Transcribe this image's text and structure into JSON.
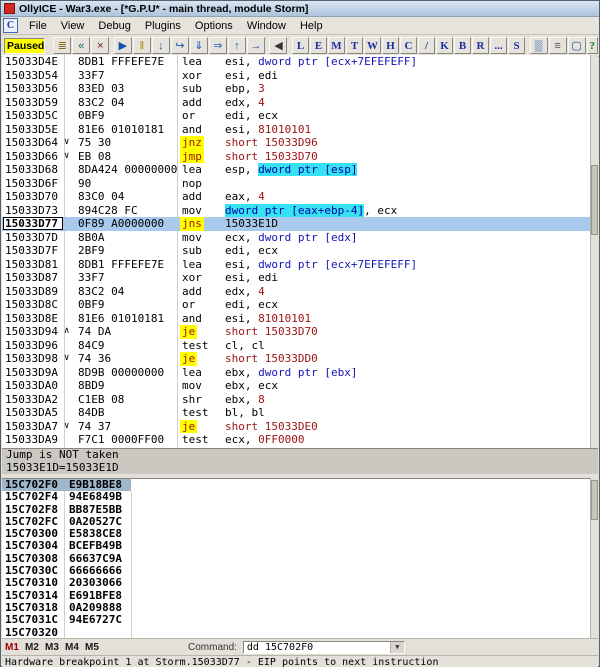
{
  "window": {
    "title": "OllyICE - War3.exe - [*G.P.U* - main thread, module Storm]"
  },
  "menu": {
    "items": [
      "File",
      "View",
      "Debug",
      "Plugins",
      "Options",
      "Window",
      "Help"
    ]
  },
  "toolbar": {
    "status": "Paused",
    "buttons_left": [
      {
        "name": "open-file",
        "glyph": "≣",
        "color": "#8A6D1A"
      },
      {
        "name": "restart",
        "glyph": "«",
        "color": "#0A6A6A"
      },
      {
        "name": "close",
        "glyph": "×",
        "color": "#7A1010"
      }
    ],
    "buttons_run": [
      {
        "name": "run",
        "glyph": "▶",
        "color": "#1553A8"
      },
      {
        "name": "pause",
        "glyph": "‖",
        "color": "#A88A00"
      },
      {
        "name": "step-into",
        "glyph": "↓",
        "color": "#1553A8"
      },
      {
        "name": "step-over",
        "glyph": "↪",
        "color": "#1553A8"
      },
      {
        "name": "animate-into",
        "glyph": "⇓",
        "color": "#1553A8"
      },
      {
        "name": "animate-over",
        "glyph": "⇒",
        "color": "#1553A8"
      },
      {
        "name": "execute-till-return",
        "glyph": "↑",
        "color": "#1553A8"
      },
      {
        "name": "go-to",
        "glyph": "→",
        "color": "#1553A8"
      }
    ],
    "buttons_mid": [
      {
        "name": "go-to-previous",
        "glyph": "◀",
        "color": "#333333"
      }
    ],
    "letter_buttons": [
      {
        "label": "L",
        "name": "log"
      },
      {
        "label": "E",
        "name": "executables"
      },
      {
        "label": "M",
        "name": "memory-map"
      },
      {
        "label": "T",
        "name": "threads"
      },
      {
        "label": "W",
        "name": "windows"
      },
      {
        "label": "H",
        "name": "handles"
      },
      {
        "label": "C",
        "name": "cpu"
      },
      {
        "label": "/",
        "name": "patches"
      },
      {
        "label": "K",
        "name": "call-stack"
      },
      {
        "label": "B",
        "name": "breakpoints"
      },
      {
        "label": "R",
        "name": "references"
      },
      {
        "label": "...",
        "name": "run-trace"
      },
      {
        "label": "S",
        "name": "source"
      }
    ],
    "buttons_right": [
      {
        "name": "patch-window",
        "glyph": "▒",
        "color": "#1553A8"
      },
      {
        "name": "options",
        "glyph": "≡",
        "color": "#555555"
      },
      {
        "name": "appearance",
        "glyph": "▢",
        "color": "#1553A8"
      }
    ],
    "help_glyph": "?"
  },
  "disasm": {
    "rows": [
      {
        "addr": "15033D4E",
        "bytes": "8DB1 FFFEFE7E",
        "mn": "lea",
        "ops": [
          {
            "t": "esi, "
          },
          {
            "t": "dword ptr [ecx+7EFEFEFF]",
            "c": "mem"
          }
        ]
      },
      {
        "addr": "15033D54",
        "bytes": "33F7",
        "mn": "xor",
        "ops": [
          {
            "t": "esi, edi"
          }
        ]
      },
      {
        "addr": "15033D56",
        "bytes": "83ED 03",
        "mn": "sub",
        "ops": [
          {
            "t": "ebp, "
          },
          {
            "t": "3",
            "c": "red"
          }
        ]
      },
      {
        "addr": "15033D59",
        "bytes": "83C2 04",
        "mn": "add",
        "ops": [
          {
            "t": "edx, "
          },
          {
            "t": "4",
            "c": "red"
          }
        ]
      },
      {
        "addr": "15033D5C",
        "bytes": "0BF9",
        "mn": "or",
        "ops": [
          {
            "t": "edi, ecx"
          }
        ]
      },
      {
        "addr": "15033D5E",
        "bytes": "81E6 01010181",
        "mn": "and",
        "ops": [
          {
            "t": "esi, "
          },
          {
            "t": "81010101",
            "c": "red"
          }
        ]
      },
      {
        "addr": "15033D64",
        "arrow": "∨",
        "bytes": "75 30",
        "mn": "jnz",
        "mnc": "jump",
        "ops": [
          {
            "t": "short 15033D96",
            "c": "red"
          }
        ]
      },
      {
        "addr": "15033D66",
        "arrow": "∨",
        "bytes": "EB 08",
        "mn": "jmp",
        "mnc": "jump",
        "ops": [
          {
            "t": "short 15033D70",
            "c": "red"
          }
        ]
      },
      {
        "addr": "15033D68",
        "bytes": "8DA424 00000000",
        "mn": "lea",
        "ops": [
          {
            "t": "esp, "
          },
          {
            "t": "dword ptr [esp]",
            "c": "hl"
          }
        ]
      },
      {
        "addr": "15033D6F",
        "bytes": "90",
        "mn": "nop",
        "ops": []
      },
      {
        "addr": "15033D70",
        "bytes": "83C0 04",
        "mn": "add",
        "ops": [
          {
            "t": "eax, "
          },
          {
            "t": "4",
            "c": "red"
          }
        ]
      },
      {
        "addr": "15033D73",
        "bytes": "894C28 FC",
        "mn": "mov",
        "ops": [
          {
            "t": "dword ptr [eax+ebp-4]",
            "c": "hl"
          },
          {
            "t": ", ecx"
          }
        ]
      },
      {
        "addr": "15033D77",
        "bytes": "0F89 A0000000",
        "mn": "jns",
        "mnc": "jump",
        "ops": [
          {
            "t": "15033E1D"
          }
        ],
        "sel": true,
        "eip": true
      },
      {
        "addr": "15033D7D",
        "bytes": "8B0A",
        "mn": "mov",
        "ops": [
          {
            "t": "ecx, "
          },
          {
            "t": "dword ptr [edx]",
            "c": "mem"
          }
        ]
      },
      {
        "addr": "15033D7F",
        "bytes": "2BF9",
        "mn": "sub",
        "ops": [
          {
            "t": "edi, ecx"
          }
        ]
      },
      {
        "addr": "15033D81",
        "bytes": "8DB1 FFFEFE7E",
        "mn": "lea",
        "ops": [
          {
            "t": "esi, "
          },
          {
            "t": "dword ptr [ecx+7EFEFEFF]",
            "c": "mem"
          }
        ]
      },
      {
        "addr": "15033D87",
        "bytes": "33F7",
        "mn": "xor",
        "ops": [
          {
            "t": "esi, edi"
          }
        ]
      },
      {
        "addr": "15033D89",
        "bytes": "83C2 04",
        "mn": "add",
        "ops": [
          {
            "t": "edx, "
          },
          {
            "t": "4",
            "c": "red"
          }
        ]
      },
      {
        "addr": "15033D8C",
        "bytes": "0BF9",
        "mn": "or",
        "ops": [
          {
            "t": "edi, ecx"
          }
        ]
      },
      {
        "addr": "15033D8E",
        "bytes": "81E6 01010181",
        "mn": "and",
        "ops": [
          {
            "t": "esi, "
          },
          {
            "t": "81010101",
            "c": "red"
          }
        ]
      },
      {
        "addr": "15033D94",
        "arrow": "∧",
        "bytes": "74 DA",
        "mn": "je",
        "mnc": "jump",
        "ops": [
          {
            "t": "short 15033D70",
            "c": "red"
          }
        ]
      },
      {
        "addr": "15033D96",
        "bytes": "84C9",
        "mn": "test",
        "ops": [
          {
            "t": "cl, cl"
          }
        ]
      },
      {
        "addr": "15033D98",
        "arrow": "∨",
        "bytes": "74 36",
        "mn": "je",
        "mnc": "jump",
        "ops": [
          {
            "t": "short 15033DD0",
            "c": "red"
          }
        ]
      },
      {
        "addr": "15033D9A",
        "bytes": "8D9B 00000000",
        "mn": "lea",
        "ops": [
          {
            "t": "ebx, "
          },
          {
            "t": "dword ptr [ebx]",
            "c": "mem"
          }
        ]
      },
      {
        "addr": "15033DA0",
        "bytes": "8BD9",
        "mn": "mov",
        "ops": [
          {
            "t": "ebx, ecx"
          }
        ]
      },
      {
        "addr": "15033DA2",
        "bytes": "C1EB 08",
        "mn": "shr",
        "ops": [
          {
            "t": "ebx, "
          },
          {
            "t": "8",
            "c": "red"
          }
        ]
      },
      {
        "addr": "15033DA5",
        "bytes": "84DB",
        "mn": "test",
        "ops": [
          {
            "t": "bl, bl"
          }
        ]
      },
      {
        "addr": "15033DA7",
        "arrow": "∨",
        "bytes": "74 37",
        "mn": "je",
        "mnc": "jump",
        "ops": [
          {
            "t": "short 15033DE0",
            "c": "red"
          }
        ]
      },
      {
        "addr": "15033DA9",
        "bytes": "F7C1 0000FF00",
        "mn": "test",
        "ops": [
          {
            "t": "ecx, "
          },
          {
            "t": "0FF0000",
            "c": "red"
          }
        ]
      }
    ]
  },
  "info": {
    "lines": [
      "Jump is NOT taken",
      "15033E1D=15033E1D"
    ]
  },
  "dump": {
    "rows": [
      {
        "addr": "15C702F0",
        "val": "E9B18BE8",
        "sel": true
      },
      {
        "addr": "15C702F4",
        "val": "94E6849B"
      },
      {
        "addr": "15C702F8",
        "val": "BB87E5BB"
      },
      {
        "addr": "15C702FC",
        "val": "0A20527C"
      },
      {
        "addr": "15C70300",
        "val": "E5838CE8"
      },
      {
        "addr": "15C70304",
        "val": "BCEFB49B"
      },
      {
        "addr": "15C70308",
        "val": "66637C9A"
      },
      {
        "addr": "15C7030C",
        "val": "66666666"
      },
      {
        "addr": "15C70310",
        "val": "20303066"
      },
      {
        "addr": "15C70314",
        "val": "E691BFE8"
      },
      {
        "addr": "15C70318",
        "val": "0A209888"
      },
      {
        "addr": "15C7031C",
        "val": "94E6727C"
      },
      {
        "addr": "15C70320",
        "val": ""
      }
    ]
  },
  "bottom": {
    "tabs": [
      "M1",
      "M2",
      "M3",
      "M4",
      "M5"
    ],
    "command_label": "Command:",
    "command_value": "dd 15C702F0"
  },
  "statusbar": {
    "text": "Hardware breakpoint 1 at Storm.15033D77 - EIP points to next instruction"
  }
}
